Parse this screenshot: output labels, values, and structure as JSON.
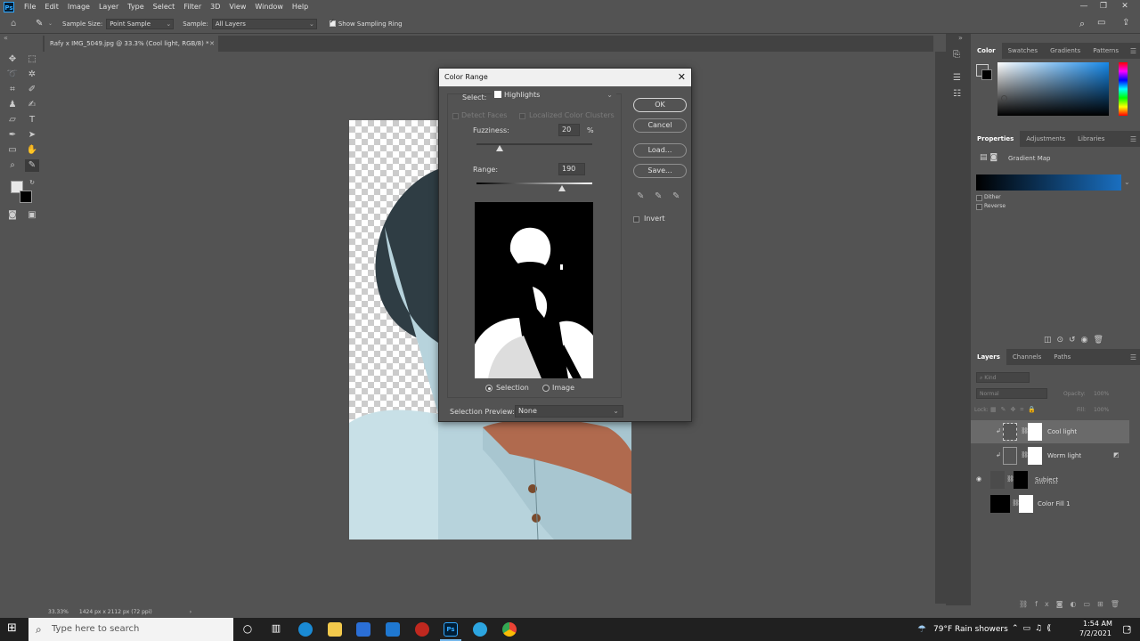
{
  "menubar": {
    "logo": "Ps",
    "items": [
      "File",
      "Edit",
      "Image",
      "Layer",
      "Type",
      "Select",
      "Filter",
      "3D",
      "View",
      "Window",
      "Help"
    ]
  },
  "options": {
    "sample_size_label": "Sample Size:",
    "sample_size_value": "Point Sample",
    "sample_label": "Sample:",
    "sample_value": "All Layers",
    "show_ring_label": "Show Sampling Ring",
    "show_ring_checked": true
  },
  "document": {
    "tab_title": "Rafy x IMG_5049.jpg @ 33.3% (Cool light, RGB/8) *"
  },
  "status": {
    "zoom": "33.33%",
    "doc_info": "1424 px x 2112 px (72 ppi)"
  },
  "dialog": {
    "title": "Color Range",
    "select_label": "Select:",
    "select_value": "Highlights",
    "detect_faces": "Detect Faces",
    "localized_clusters": "Localized Color Clusters",
    "fuzziness_label": "Fuzziness:",
    "fuzziness_value": "20",
    "fuzziness_unit": "%",
    "fuzziness_fraction": 0.2,
    "range_label": "Range:",
    "range_value": "190",
    "range_fraction": 0.74,
    "ok": "OK",
    "cancel": "Cancel",
    "load": "Load...",
    "save": "Save...",
    "invert": "Invert",
    "radio_selection": "Selection",
    "radio_image": "Image",
    "preview_label": "Selection Preview:",
    "preview_value": "None"
  },
  "panels": {
    "color_tabs": [
      "Color",
      "Swatches",
      "Gradients",
      "Patterns"
    ],
    "props_tabs": [
      "Properties",
      "Adjustments",
      "Libraries"
    ],
    "props_title": "Gradient Map",
    "dither": "Dither",
    "reverse": "Reverse",
    "layers_tabs": [
      "Layers",
      "Channels",
      "Paths"
    ],
    "kind_placeholder": "Kind",
    "blend_mode": "Normal",
    "opacity_label": "Opacity:",
    "opacity_value": "100%",
    "lock_label": "Lock:",
    "fill_label": "Fill:",
    "fill_value": "100%",
    "layers": [
      "Cool light",
      "Worm light",
      "Subject",
      "Color Fill 1"
    ]
  },
  "taskbar": {
    "search_placeholder": "Type here to search",
    "weather": "79°F  Rain showers",
    "time": "1:54 AM",
    "date": "7/2/2021",
    "notifications": "2"
  },
  "colors": {
    "app_bg": "#535353",
    "panel_dark": "#424242",
    "gradient_start": "#000000",
    "gradient_end": "#1a6fc0"
  }
}
